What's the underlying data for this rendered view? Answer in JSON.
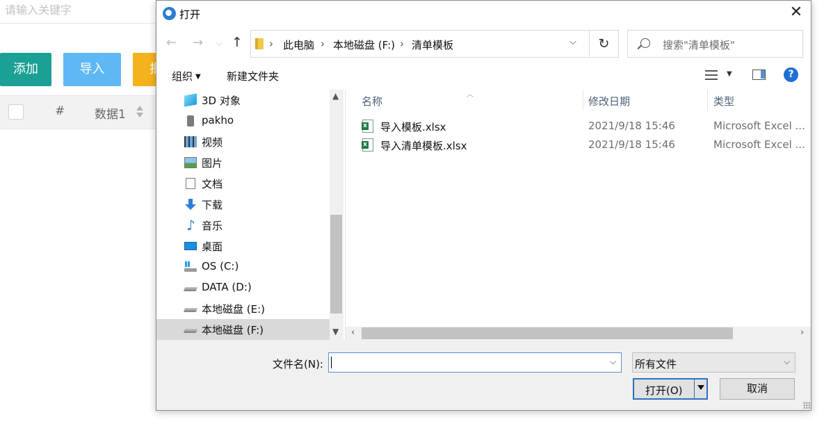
{
  "background": {
    "search_placeholder": "请输入关键字",
    "buttons": {
      "add": "添加",
      "import": "导入",
      "more": "批"
    },
    "table_head": {
      "hash": "#",
      "col1": "数据1"
    }
  },
  "dialog": {
    "title": "打开",
    "close": "✕",
    "breadcrumb": [
      "此电脑",
      "本地磁盘 (F:)",
      "清单模板"
    ],
    "search_placeholder": "搜索\"清单模板\"",
    "toolbar": {
      "organize": "组织",
      "new_folder": "新建文件夹",
      "help": "?"
    },
    "nav_items": [
      {
        "label": "3D 对象",
        "icon": "cube-3d-icon",
        "selected": false
      },
      {
        "label": "pakho",
        "icon": "user-icon",
        "selected": false
      },
      {
        "label": "视频",
        "icon": "video-icon",
        "selected": false
      },
      {
        "label": "图片",
        "icon": "picture-icon",
        "selected": false
      },
      {
        "label": "文档",
        "icon": "document-icon",
        "selected": false
      },
      {
        "label": "下载",
        "icon": "download-icon",
        "selected": false
      },
      {
        "label": "音乐",
        "icon": "music-icon",
        "selected": false
      },
      {
        "label": "桌面",
        "icon": "desktop-icon",
        "selected": false
      },
      {
        "label": "OS (C:)",
        "icon": "os-drive-icon",
        "selected": false
      },
      {
        "label": "DATA (D:)",
        "icon": "drive-icon",
        "selected": false
      },
      {
        "label": "本地磁盘 (E:)",
        "icon": "drive-icon",
        "selected": false
      },
      {
        "label": "本地磁盘 (F:)",
        "icon": "drive-icon",
        "selected": true
      }
    ],
    "columns": {
      "name": "名称",
      "date": "修改日期",
      "type": "类型"
    },
    "files": [
      {
        "name": "导入模板.xlsx",
        "date": "2021/9/18 15:46",
        "type": "Microsoft Excel ..."
      },
      {
        "name": "导入清单模板.xlsx",
        "date": "2021/9/18 15:46",
        "type": "Microsoft Excel ..."
      }
    ],
    "filename_label": "文件名(N):",
    "filename_value": "",
    "file_type": "所有文件",
    "open_button": "打开(O)",
    "cancel_button": "取消"
  },
  "colors": {
    "accent": "#1aa094",
    "import": "#5fb8f5",
    "warn": "#f5b21c",
    "dialog_focus": "#2f6fc0"
  }
}
